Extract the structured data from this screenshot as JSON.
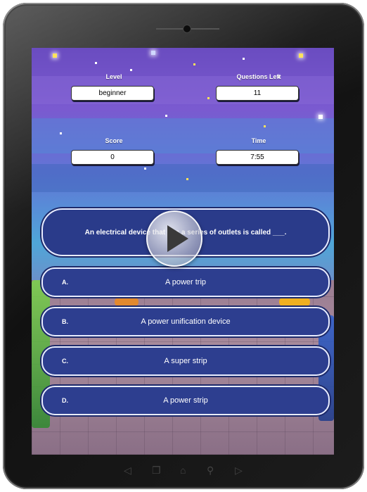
{
  "stats": {
    "level": {
      "label": "Level",
      "value": "beginner"
    },
    "questions_left": {
      "label": "Questions Left",
      "value": "11"
    },
    "score": {
      "label": "Score",
      "value": "0"
    },
    "time": {
      "label": "Time",
      "value": "7:55"
    }
  },
  "question": "An electrical device that has a series of outlets is called ___.",
  "answers": [
    {
      "letter": "A.",
      "text": "A power trip"
    },
    {
      "letter": "B.",
      "text": "A power unification device"
    },
    {
      "letter": "C.",
      "text": "A super strip"
    },
    {
      "letter": "D.",
      "text": "A power strip"
    }
  ],
  "icons": {
    "play": "play-icon",
    "nav_back": "back-icon",
    "nav_recent": "recent-apps-icon",
    "nav_home": "home-icon",
    "nav_search": "search-icon",
    "nav_forward": "forward-icon"
  },
  "colors": {
    "answer_fill": "#2d3e8f",
    "answer_border": "#e8ecff",
    "sky_top": "#6a4cc0",
    "sky_mid": "#4fa6d8"
  }
}
